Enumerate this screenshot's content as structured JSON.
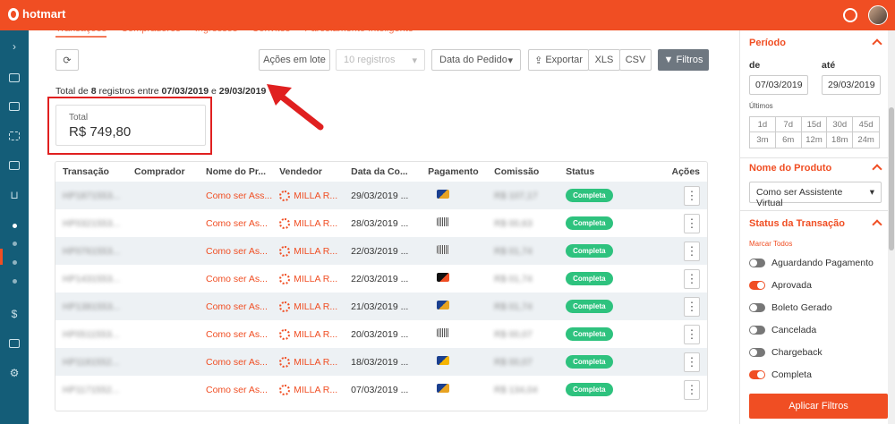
{
  "brand": {
    "name": "hotmart",
    "accent": "#f04e23",
    "nav_bg": "#145d78"
  },
  "tabs": [
    "Transações",
    "Compradores",
    "Ingressos",
    "Convites",
    "Parcelamento Inteligente"
  ],
  "toolbar": {
    "acoes_label": "Ações em lote",
    "registros_label": "10 registros",
    "pedido_label": "Data do Pedido",
    "exportar_label": "Exportar",
    "xls_label": "XLS",
    "csv_label": "CSV",
    "filtros_label": "Filtros"
  },
  "summary": {
    "prefix": "Total de ",
    "count": "8",
    "middle": " registros entre ",
    "start": "07/03/2019",
    "e": " e ",
    "end": "29/03/2019"
  },
  "total": {
    "label": "Total",
    "value": "R$ 749,80"
  },
  "table": {
    "headers": [
      "Transação",
      "Comprador",
      "Nome do Pr...",
      "Vendedor",
      "Data da Co...",
      "Pagamento",
      "Comissão",
      "Status",
      "Ações"
    ],
    "rows": [
      {
        "tx": "HP1871553...",
        "prod": "Como ser Ass...",
        "vend": "MILLA R...",
        "date": "29/03/2019 ...",
        "pay": "card",
        "com": "R$ 107,17",
        "status": "Completa"
      },
      {
        "tx": "HP0321553...",
        "prod": "Como ser As...",
        "vend": "MILLA R...",
        "date": "28/03/2019 ...",
        "pay": "boleto",
        "com": "R$ 00,63",
        "status": "Completa"
      },
      {
        "tx": "HP0761553...",
        "prod": "Como ser As...",
        "vend": "MILLA R...",
        "date": "22/03/2019 ...",
        "pay": "boleto",
        "com": "R$ 01,74",
        "status": "Completa"
      },
      {
        "tx": "HP1431553...",
        "prod": "Como ser As...",
        "vend": "MILLA R...",
        "date": "22/03/2019 ...",
        "pay": "paypal",
        "com": "R$ 01,74",
        "status": "Completa"
      },
      {
        "tx": "HP1381553...",
        "prod": "Como ser As...",
        "vend": "MILLA R...",
        "date": "21/03/2019 ...",
        "pay": "card",
        "com": "R$ 01,74",
        "status": "Completa"
      },
      {
        "tx": "HP0511553...",
        "prod": "Como ser As...",
        "vend": "MILLA R...",
        "date": "20/03/2019 ...",
        "pay": "boleto",
        "com": "R$ 00,07",
        "status": "Completa"
      },
      {
        "tx": "HP1181552...",
        "prod": "Como ser As...",
        "vend": "MILLA R...",
        "date": "18/03/2019 ...",
        "pay": "visa",
        "com": "R$ 00,07",
        "status": "Completa"
      },
      {
        "tx": "HP1171552...",
        "prod": "Como ser As...",
        "vend": "MILLA R...",
        "date": "07/03/2019 ...",
        "pay": "card",
        "com": "R$ 134,04",
        "status": "Completa"
      }
    ]
  },
  "panel": {
    "periodo_title": "Período",
    "de_label": "de",
    "ate_label": "até",
    "de_value": "07/03/2019",
    "ate_value": "29/03/2019",
    "ultimos": "Últimos",
    "ranges": [
      "1d",
      "7d",
      "15d",
      "30d",
      "45d",
      "3m",
      "6m",
      "12m",
      "18m",
      "24m"
    ],
    "produto_title": "Nome do Produto",
    "produto_value": "Como ser Assistente Virtual",
    "status_title": "Status da Transação",
    "marcar": "Marcar Todos",
    "statuses": [
      {
        "label": "Aguardando Pagamento",
        "on": false
      },
      {
        "label": "Aprovada",
        "on": true
      },
      {
        "label": "Boleto Gerado",
        "on": false
      },
      {
        "label": "Cancelada",
        "on": false
      },
      {
        "label": "Chargeback",
        "on": false
      },
      {
        "label": "Completa",
        "on": true
      }
    ],
    "apply_label": "Aplicar Filtros"
  }
}
